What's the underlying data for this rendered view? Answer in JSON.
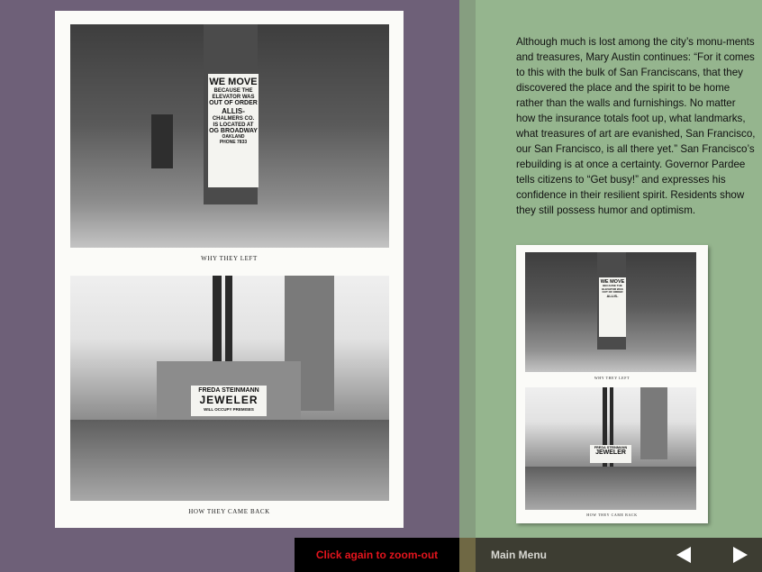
{
  "page": {
    "caption_top": "WHY THEY LEFT",
    "caption_bottom": "HOW THEY CAME BACK",
    "sign_top": [
      "WE MOVE",
      "BECAUSE THE",
      "ELEVATOR WAS",
      "OUT OF ORDER",
      "ALLIS-",
      "CHALMERS CO.",
      "IS LOCATED AT",
      "OG BROADWAY",
      "OAKLAND",
      "PHONE 7833"
    ],
    "sign_bottom": [
      "FREDA STEINMANN",
      "JEWELER",
      "WILL OCCUPY PREMISES"
    ]
  },
  "article": {
    "text": "Although much is lost among the city’s monu-ments and treasures, Mary Austin continues: “For it comes to this with the bulk of San Franciscans, that they discovered the place and the spirit to be home rather than the walls and furnishings. No matter how the insurance totals foot up, what landmarks, what treasures of art are evanished, San Francisco, our San Francisco, is all there yet.” San Francisco’s rebuilding is at once a certainty. Governor Pardee tells citizens to “Get busy!” and expresses his confidence in their resilient spirit. Residents show they still possess humor and optimism."
  },
  "thumbnail": {
    "caption_top": "WHY THEY LEFT",
    "caption_bottom": "HOW THEY CAME BACK",
    "sign_top": [
      "WE MOVE",
      "BECAUSE THE",
      "ELEVATOR WAS",
      "OUT OF ORDER",
      "ALLIS-"
    ],
    "sign_bottom": [
      "FREDA STEINMANN",
      "JEWELER"
    ]
  },
  "bottom_bar": {
    "zoom_message": "Click again to zoom-out",
    "main_menu": "Main Menu",
    "prev_icon": "triangle-left",
    "next_icon": "triangle-right"
  },
  "colors": {
    "left_bg": "#6e6078",
    "right_bg": "#95b58e",
    "zoom_text": "#e3141d"
  }
}
